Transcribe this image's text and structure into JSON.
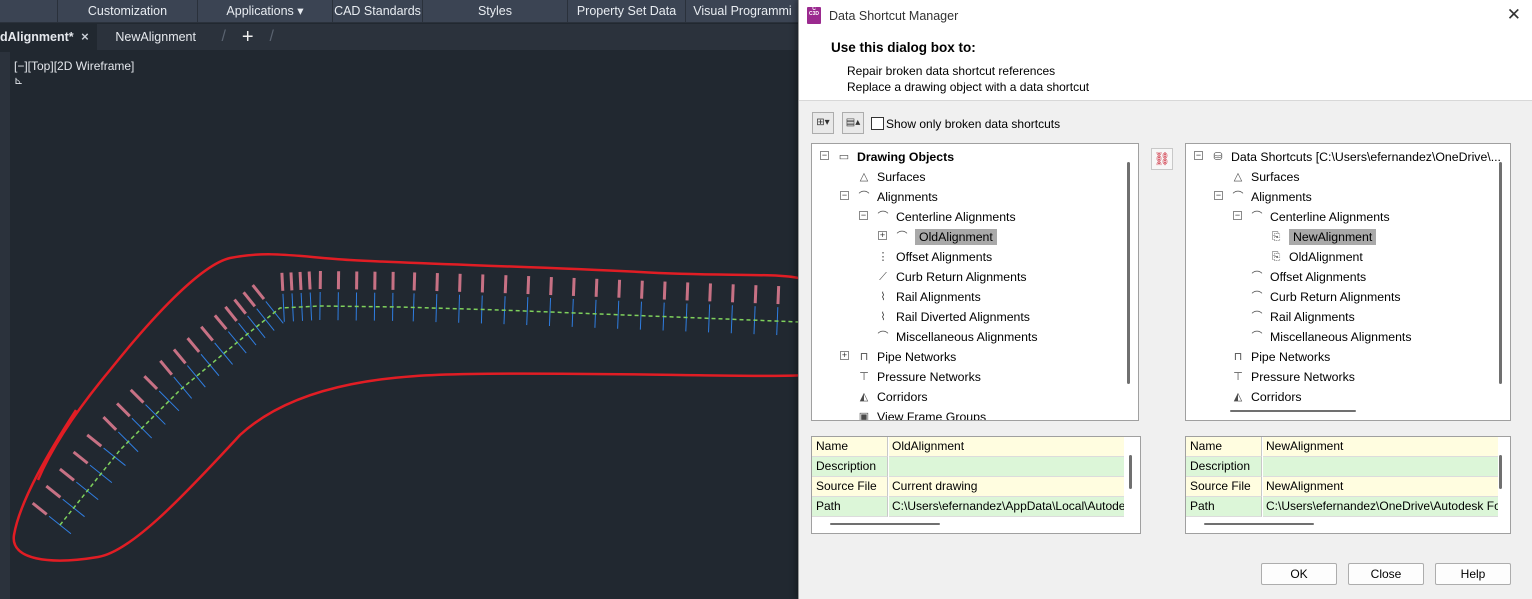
{
  "ribbon": {
    "tabs": [
      "",
      "Customization",
      "Applications",
      "CAD Standards",
      "Styles",
      "Property Set Data",
      "Visual Programmi"
    ],
    "applications_dropdown": "▾"
  },
  "doc_tabs": {
    "active": "dAlignment*",
    "close": "×",
    "second": "NewAlignment",
    "plus": "+"
  },
  "viewport": {
    "label": "[−][Top][2D Wireframe]"
  },
  "dialog": {
    "title": "Data Shortcut Manager",
    "app_icon_text": "C",
    "app_icon_sub": "C3D",
    "close": "✕",
    "header_title": "Use this dialog box to:",
    "header_line1": "Repair broken data shortcut references",
    "header_line2": "Replace a drawing object with a data shortcut",
    "show_broken_label": "Show only broken data shortcuts",
    "left_tree": [
      {
        "label": "Drawing Objects",
        "bold": true,
        "icon": "folder-icon"
      },
      {
        "label": "Surfaces",
        "icon": "surface-icon"
      },
      {
        "label": "Alignments",
        "icon": "alignment-icon"
      },
      {
        "label": "Centerline Alignments",
        "icon": "alignment-icon"
      },
      {
        "label": "OldAlignment",
        "icon": "alignment-icon",
        "selected": true
      },
      {
        "label": "Offset Alignments",
        "icon": "offset-alignment-icon"
      },
      {
        "label": "Curb Return Alignments",
        "icon": "curb-return-icon"
      },
      {
        "label": "Rail Alignments",
        "icon": "rail-alignment-icon"
      },
      {
        "label": "Rail Diverted Alignments",
        "icon": "rail-alignment-icon"
      },
      {
        "label": "Miscellaneous Alignments",
        "icon": "alignment-icon"
      },
      {
        "label": "Pipe Networks",
        "icon": "pipe-network-icon"
      },
      {
        "label": "Pressure Networks",
        "icon": "pressure-network-icon"
      },
      {
        "label": "Corridors",
        "icon": "corridor-icon"
      },
      {
        "label": "View Frame Groups",
        "icon": "view-frame-icon"
      }
    ],
    "right_tree": [
      {
        "label": "Data Shortcuts [C:\\Users\\efernandez\\OneDrive\\...",
        "icon": "database-icon"
      },
      {
        "label": "Surfaces",
        "icon": "surface-icon"
      },
      {
        "label": "Alignments",
        "icon": "alignment-icon"
      },
      {
        "label": "Centerline Alignments",
        "icon": "alignment-icon"
      },
      {
        "label": "NewAlignment",
        "icon": "shortcut-icon",
        "selected": true
      },
      {
        "label": "OldAlignment",
        "icon": "shortcut-icon"
      },
      {
        "label": "Offset Alignments",
        "icon": "alignment-icon"
      },
      {
        "label": "Curb Return Alignments",
        "icon": "alignment-icon"
      },
      {
        "label": "Rail Alignments",
        "icon": "alignment-icon"
      },
      {
        "label": "Miscellaneous Alignments",
        "icon": "alignment-icon"
      },
      {
        "label": "Pipe Networks",
        "icon": "pipe-network-icon"
      },
      {
        "label": "Pressure Networks",
        "icon": "pressure-network-icon"
      },
      {
        "label": "Corridors",
        "icon": "corridor-icon"
      }
    ],
    "left_props": [
      {
        "name": "Name",
        "value": "OldAlignment"
      },
      {
        "name": "Description",
        "value": ""
      },
      {
        "name": "Source File",
        "value": "Current drawing"
      },
      {
        "name": "Path",
        "value": "C:\\Users\\efernandez\\AppData\\Local\\Autode"
      }
    ],
    "right_props": [
      {
        "name": "Name",
        "value": "NewAlignment"
      },
      {
        "name": "Description",
        "value": ""
      },
      {
        "name": "Source File",
        "value": "NewAlignment"
      },
      {
        "name": "Path",
        "value": "C:\\Users\\efernandez\\OneDrive\\Autodesk Fo"
      }
    ],
    "buttons": {
      "ok": "OK",
      "close": "Close",
      "help": "Help"
    }
  },
  "colors": {
    "annotation_red": "#e11d24",
    "station_label": "#ff8aa0",
    "tick_blue": "#2f7de0",
    "alignment_green": "#7fd15c",
    "selected_row": "#a9a9a9",
    "prop_yellow": "#fffde0",
    "prop_green": "#dcf6d8"
  }
}
